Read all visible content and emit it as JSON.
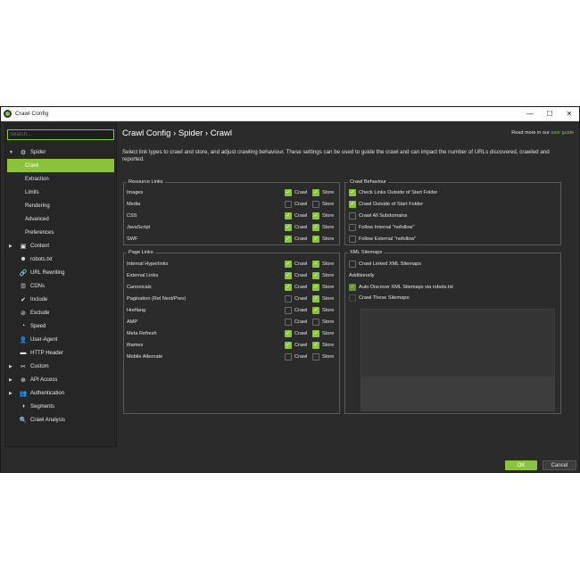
{
  "window": {
    "title": "Crawl Config",
    "minimize": "—",
    "maximize": "☐",
    "close": "✕"
  },
  "search": {
    "value": "",
    "placeholder": "Search..."
  },
  "sidebar": {
    "spider": "Spider",
    "sub": [
      "Crawl",
      "Extraction",
      "Limits",
      "Rendering",
      "Advanced",
      "Preferences"
    ],
    "items": [
      "Content",
      "robots.txt",
      "URL Rewriting",
      "CDNs",
      "Include",
      "Exclude",
      "Speed",
      "User-Agent",
      "HTTP Header",
      "Custom",
      "API Access",
      "Authentication",
      "Segments",
      "Crawl Analysis"
    ]
  },
  "header": {
    "breadcrumb": "Crawl Config › Spider › Crawl",
    "learn_prefix": "Read more in our ",
    "learn_link": "user guide",
    "description": "Select link types to crawl and store, and adjust crawling behaviour. These settings can be used to guide the crawl and can impact the number of URLs discovered, crawled and reported."
  },
  "labels": {
    "crawl": "Crawl",
    "store": "Store"
  },
  "resource_links": {
    "title": "Resource Links",
    "rows": [
      {
        "label": "Images",
        "crawl": true,
        "store": true
      },
      {
        "label": "Media",
        "crawl": false,
        "store": false
      },
      {
        "label": "CSS",
        "crawl": true,
        "store": true
      },
      {
        "label": "JavaScript",
        "crawl": true,
        "store": true
      },
      {
        "label": "SWF",
        "crawl": true,
        "store": true
      }
    ]
  },
  "page_links": {
    "title": "Page Links",
    "rows": [
      {
        "label": "Internal Hyperlinks",
        "crawl": true,
        "store": true
      },
      {
        "label": "External Links",
        "crawl": true,
        "store": true
      },
      {
        "label": "Canonicals",
        "crawl": true,
        "store": true
      },
      {
        "label": "Pagination (Rel Next/Prev)",
        "crawl": false,
        "store": true
      },
      {
        "label": "Hreflang",
        "crawl": false,
        "store": true
      },
      {
        "label": "AMP",
        "crawl": false,
        "store": false
      },
      {
        "label": "Meta Refresh",
        "crawl": true,
        "store": true
      },
      {
        "label": "iframes",
        "crawl": true,
        "store": true
      },
      {
        "label": "Mobile Alternate",
        "crawl": false,
        "store": false
      }
    ]
  },
  "crawl_behaviour": {
    "title": "Crawl Behaviour",
    "rows": [
      {
        "label": "Check Links Outside of Start Folder",
        "checked": true
      },
      {
        "label": "Crawl Outside of Start Folder",
        "checked": true
      },
      {
        "label": "Crawl All Subdomains",
        "checked": false
      },
      {
        "label": "Follow Internal \"nofollow\"",
        "checked": false
      },
      {
        "label": "Follow External \"nofollow\"",
        "checked": false
      }
    ]
  },
  "xml_sitemaps": {
    "title": "XML Sitemaps",
    "crawl_linked": {
      "label": "Crawl Linked XML Sitemaps",
      "checked": false
    },
    "additionally": "Additionally",
    "auto_discover": {
      "label": "Auto Discover XML Sitemaps via robots.txt",
      "checked": true
    },
    "crawl_these": {
      "label": "Crawl These Sitemaps:",
      "checked": false
    }
  },
  "footer": {
    "ok": "OK",
    "cancel": "Cancel"
  },
  "colors": {
    "accent": "#8ac43f",
    "bg": "#2b2b2b"
  }
}
